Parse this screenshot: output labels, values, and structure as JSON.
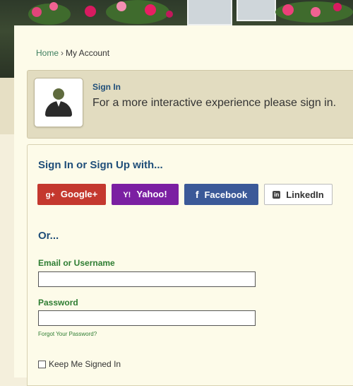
{
  "breadcrumb": {
    "home": "Home",
    "separator": "›",
    "current": "My Account"
  },
  "signin_banner": {
    "title": "Sign In",
    "subtitle": "For a more interactive experience please sign in."
  },
  "social": {
    "heading": "Sign In or Sign Up with...",
    "buttons": [
      {
        "label": "Google+",
        "icon": "google-plus-icon",
        "color": "#c4382e"
      },
      {
        "label": "Yahoo!",
        "icon": "yahoo-icon",
        "color": "#7b1fa2"
      },
      {
        "label": "Facebook",
        "icon": "facebook-icon",
        "color": "#3b5998"
      },
      {
        "label": "LinkedIn",
        "icon": "linkedin-icon",
        "color": "#ffffff"
      }
    ]
  },
  "form": {
    "or_heading": "Or...",
    "email_label": "Email or Username",
    "email_value": "",
    "password_label": "Password",
    "password_value": "",
    "forgot_link": "Forgot Your Password?",
    "keep_signed_in": "Keep Me Signed In"
  },
  "colors": {
    "heading_blue": "#1f4e79",
    "label_green": "#2e7d32",
    "link_green": "#3f7f5f",
    "panel_bg": "#fdfbe9",
    "banner_bg": "#e2dcc0"
  }
}
